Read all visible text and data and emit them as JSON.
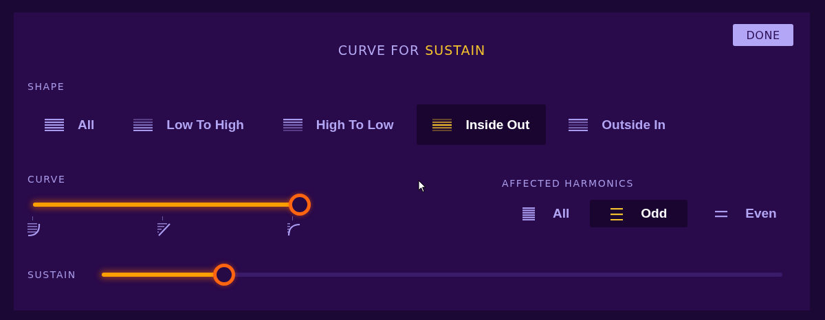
{
  "header": {
    "title": "CURVE FOR",
    "parameter": "SUSTAIN",
    "done_button": "DONE"
  },
  "shape": {
    "label": "SHAPE",
    "options": [
      {
        "label": "All",
        "kind": "all",
        "selected": false
      },
      {
        "label": "Low To High",
        "kind": "low_to_high",
        "selected": false
      },
      {
        "label": "High To Low",
        "kind": "high_to_low",
        "selected": false
      },
      {
        "label": "Inside Out",
        "kind": "inside_out",
        "selected": true
      },
      {
        "label": "Outside In",
        "kind": "outside_in",
        "selected": false
      }
    ]
  },
  "curve": {
    "label": "CURVE",
    "level": 1.0,
    "markers": [
      {
        "kind": "log"
      },
      {
        "kind": "linear"
      },
      {
        "kind": "exp"
      }
    ]
  },
  "affected_harmonics": {
    "label": "AFFECTED HARMONICS",
    "options": [
      {
        "label": "All",
        "kind": "all",
        "selected": false
      },
      {
        "label": "Odd",
        "kind": "odd",
        "selected": true
      },
      {
        "label": "Even",
        "kind": "even",
        "selected": false
      }
    ]
  },
  "sustain": {
    "label": "SUSTAIN",
    "level": 0.18
  }
}
